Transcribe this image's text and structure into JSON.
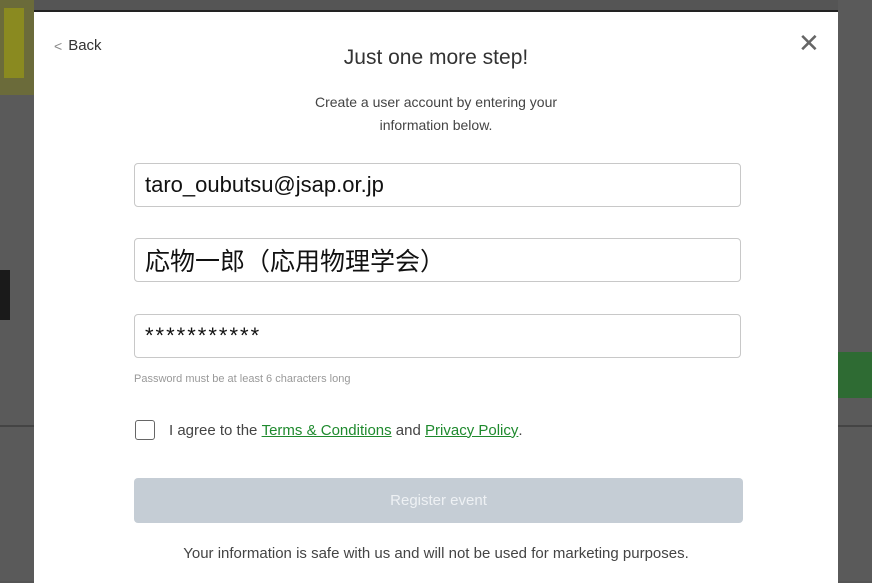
{
  "modal": {
    "back_label": "Back",
    "close_glyph": "✕",
    "title": "Just one more step!",
    "subtitle": "Create a user account by entering your information below."
  },
  "form": {
    "email_value": "taro_oubutsu@jsap.or.jp",
    "name_value": "応物一郎（応用物理学会）",
    "password_value": "***********",
    "password_hint": "Password must be at least 6 characters long",
    "agree_prefix": "I agree to the ",
    "terms_link": "Terms & Conditions",
    "agree_middle": " and ",
    "privacy_link": "Privacy Policy",
    "agree_suffix": ".",
    "register_label": "Register event",
    "footer_note": "Your information is safe with us and will not be used for marketing purposes."
  },
  "colors": {
    "link": "#1f8a2e",
    "register_disabled_bg": "#c5cdd5",
    "overlay": "#555555"
  }
}
